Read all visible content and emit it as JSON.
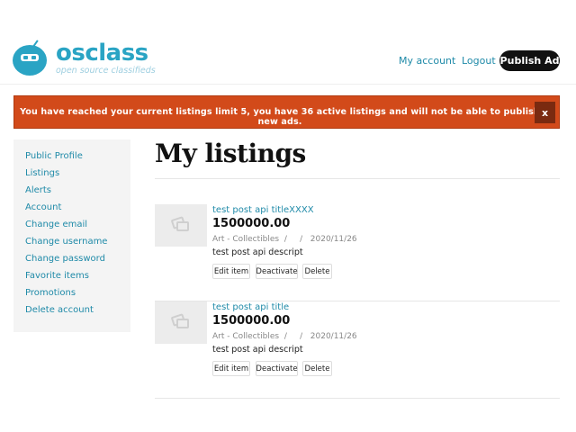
{
  "header": {
    "logo_word": "osclass",
    "logo_tagline": "open source classifieds",
    "nav": {
      "my_account": "My account",
      "logout": "Logout",
      "publish": "Publish Ad"
    }
  },
  "alert": {
    "message": "You have reached your current listings limit 5, you have 36 active listings and will not be able to publish new ads.",
    "close_label": "x"
  },
  "sidebar": {
    "items": [
      {
        "label": "Public Profile"
      },
      {
        "label": "Listings"
      },
      {
        "label": "Alerts"
      },
      {
        "label": "Account"
      },
      {
        "label": "Change email"
      },
      {
        "label": "Change username"
      },
      {
        "label": "Change password"
      },
      {
        "label": "Favorite items"
      },
      {
        "label": "Promotions"
      },
      {
        "label": "Delete account"
      }
    ]
  },
  "main": {
    "title": "My listings",
    "listings": [
      {
        "title": "test post api titleXXXX",
        "price": "1500000.00",
        "meta": "Art - Collectibles  /     /   2020/11/26",
        "description": "test post api descript",
        "actions": {
          "edit": "Edit item",
          "deactivate": "Deactivate",
          "delete": "Delete"
        }
      },
      {
        "title": "test post api title",
        "price": "1500000.00",
        "meta": "Art - Collectibles  /     /   2020/11/26",
        "description": "test post api descript",
        "actions": {
          "edit": "Edit item",
          "deactivate": "Deactivate",
          "delete": "Delete"
        }
      }
    ]
  },
  "colors": {
    "brand": "#2aa4c4",
    "link": "#1f8aa8",
    "alert_bg": "#d24a1a",
    "publish_bg": "#111111"
  },
  "icons": {
    "logo": "osclass-mascot-icon",
    "thumbnail": "image-placeholder-icon"
  }
}
